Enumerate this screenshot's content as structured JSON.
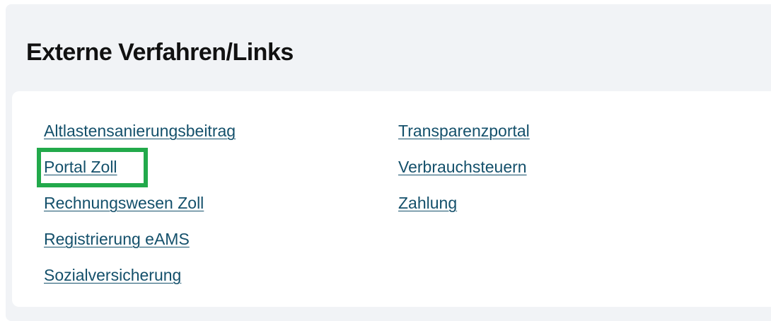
{
  "panel": {
    "title": "Externe Verfahren/Links"
  },
  "links": {
    "left": [
      {
        "label": "Altlastensanierungsbeitrag"
      },
      {
        "label": "Portal Zoll"
      },
      {
        "label": "Rechnungswesen Zoll"
      },
      {
        "label": "Registrierung eAMS"
      },
      {
        "label": "Sozialversicherung"
      }
    ],
    "right": [
      {
        "label": "Transparenzportal"
      },
      {
        "label": "Verbrauchsteuern"
      },
      {
        "label": "Zahlung"
      }
    ]
  },
  "colors": {
    "link": "#14506b",
    "panel_background": "#f1f3f6",
    "highlight": "#22a94b"
  },
  "highlight": {
    "target": "Portal Zoll"
  }
}
